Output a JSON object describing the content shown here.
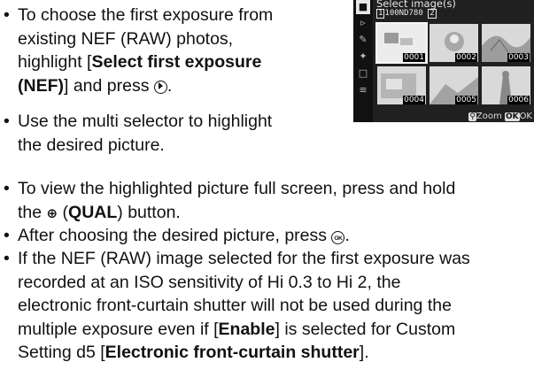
{
  "bullets": [
    {
      "lines": [
        [
          {
            "t": "To choose the first exposure from"
          }
        ],
        [
          {
            "t": "existing NEF (RAW) photos,"
          }
        ],
        [
          {
            "t": "highlight ["
          },
          {
            "t": "Select first exposure",
            "b": true
          }
        ],
        [
          {
            "t": "(NEF)",
            "b": true
          },
          {
            "t": "] and press "
          },
          {
            "sym": "multi-selector-right"
          },
          {
            "t": "."
          }
        ]
      ]
    },
    {
      "lines": [
        [
          {
            "t": "Use the multi selector to highlight"
          }
        ],
        [
          {
            "t": "the desired picture."
          }
        ]
      ]
    },
    {
      "lines": [
        [
          {
            "t": "To view the highlighted picture full screen, press and hold"
          }
        ],
        [
          {
            "t": "the "
          },
          {
            "sym": "zoom-in"
          },
          {
            "t": " ("
          },
          {
            "t": "QUAL",
            "b": true
          },
          {
            "t": ") button."
          }
        ]
      ]
    },
    {
      "lines": [
        [
          {
            "t": "After choosing the desired picture, press "
          },
          {
            "sym": "ok"
          },
          {
            "t": "."
          }
        ]
      ]
    },
    {
      "lines": [
        [
          {
            "t": "If the NEF (RAW) image selected for the first exposure was"
          }
        ],
        [
          {
            "t": "recorded at an ISO sensitivity of Hi 0.3 to Hi 2, the"
          }
        ],
        [
          {
            "t": "electronic front-curtain shutter will not be used during the"
          }
        ],
        [
          {
            "t": "multiple exposure even if ["
          },
          {
            "t": "Enable",
            "b": true
          },
          {
            "t": "] is selected for Custom"
          }
        ],
        [
          {
            "t": "Setting d5 ["
          },
          {
            "t": "Electronic front-curtain shutter",
            "b": true
          },
          {
            "t": "]."
          }
        ]
      ]
    }
  ],
  "camera_screen": {
    "title": "Select image(s)",
    "folder_number": "1",
    "folder_name": "100ND780",
    "folder_suffix": "2",
    "thumbnails": [
      "0001",
      "0002",
      "0003",
      "0004",
      "0005",
      "0006"
    ],
    "footer_zoom": "Zoom",
    "footer_ok": "OK",
    "footer_ok_key": "OK"
  }
}
